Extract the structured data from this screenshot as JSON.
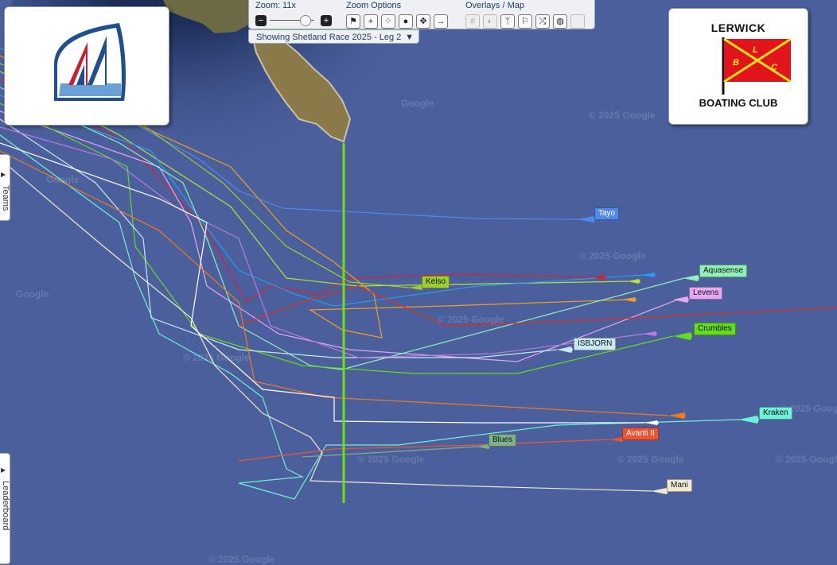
{
  "toolbar": {
    "zoom_label": "Zoom:",
    "zoom_value": "11x",
    "zoom_out_symbol": "−",
    "zoom_in_symbol": "+",
    "zoom_options_label": "Zoom Options",
    "overlays_label": "Overlays / Map",
    "zoom_option_icons": [
      "flag-icon",
      "plus-box-icon",
      "dice-icon",
      "group-icon",
      "expand-icon",
      "exit-arrow-icon"
    ],
    "overlay_icons": [
      "grid-icon",
      "contrast-icon",
      "branch-icon",
      "wind-flag-icon",
      "shuffle-icon",
      "globe-icon",
      "blank-box-icon"
    ]
  },
  "race_selector": {
    "label": "Showing Shetland Race 2025 - Leg 2",
    "arrow": "▼"
  },
  "side_tabs": {
    "teams": "Teams",
    "leaderboard": "Leaderboard"
  },
  "club_logo": {
    "line1": "LERWICK",
    "line2": "BOATING CLUB",
    "flag_letters": [
      "B",
      "L",
      "C"
    ]
  },
  "watermark": "© 2025 Google",
  "watermark_short": "Google",
  "colors": {
    "ocean": "#4a5f9c",
    "finish_line": "#6ee00f",
    "land": "#8a7a4a"
  },
  "boats": [
    {
      "name": "Tayo",
      "color": "#4f8be6"
    },
    {
      "name": "Kelso",
      "color": "#9ccf2e"
    },
    {
      "name": "Aquasense",
      "color": "#8ff0b8"
    },
    {
      "name": "Levens",
      "color": "#e6a8f0"
    },
    {
      "name": "Crumbles",
      "color": "#66dd1a"
    },
    {
      "name": "ISBJORN",
      "color": "#c8e8f2"
    },
    {
      "name": "Kraken",
      "color": "#6ff0d8"
    },
    {
      "name": "Avanti II",
      "color": "#ee5533"
    },
    {
      "name": "Blues",
      "color": "#7fb08a"
    },
    {
      "name": "Mani",
      "color": "#f0ead0"
    }
  ]
}
